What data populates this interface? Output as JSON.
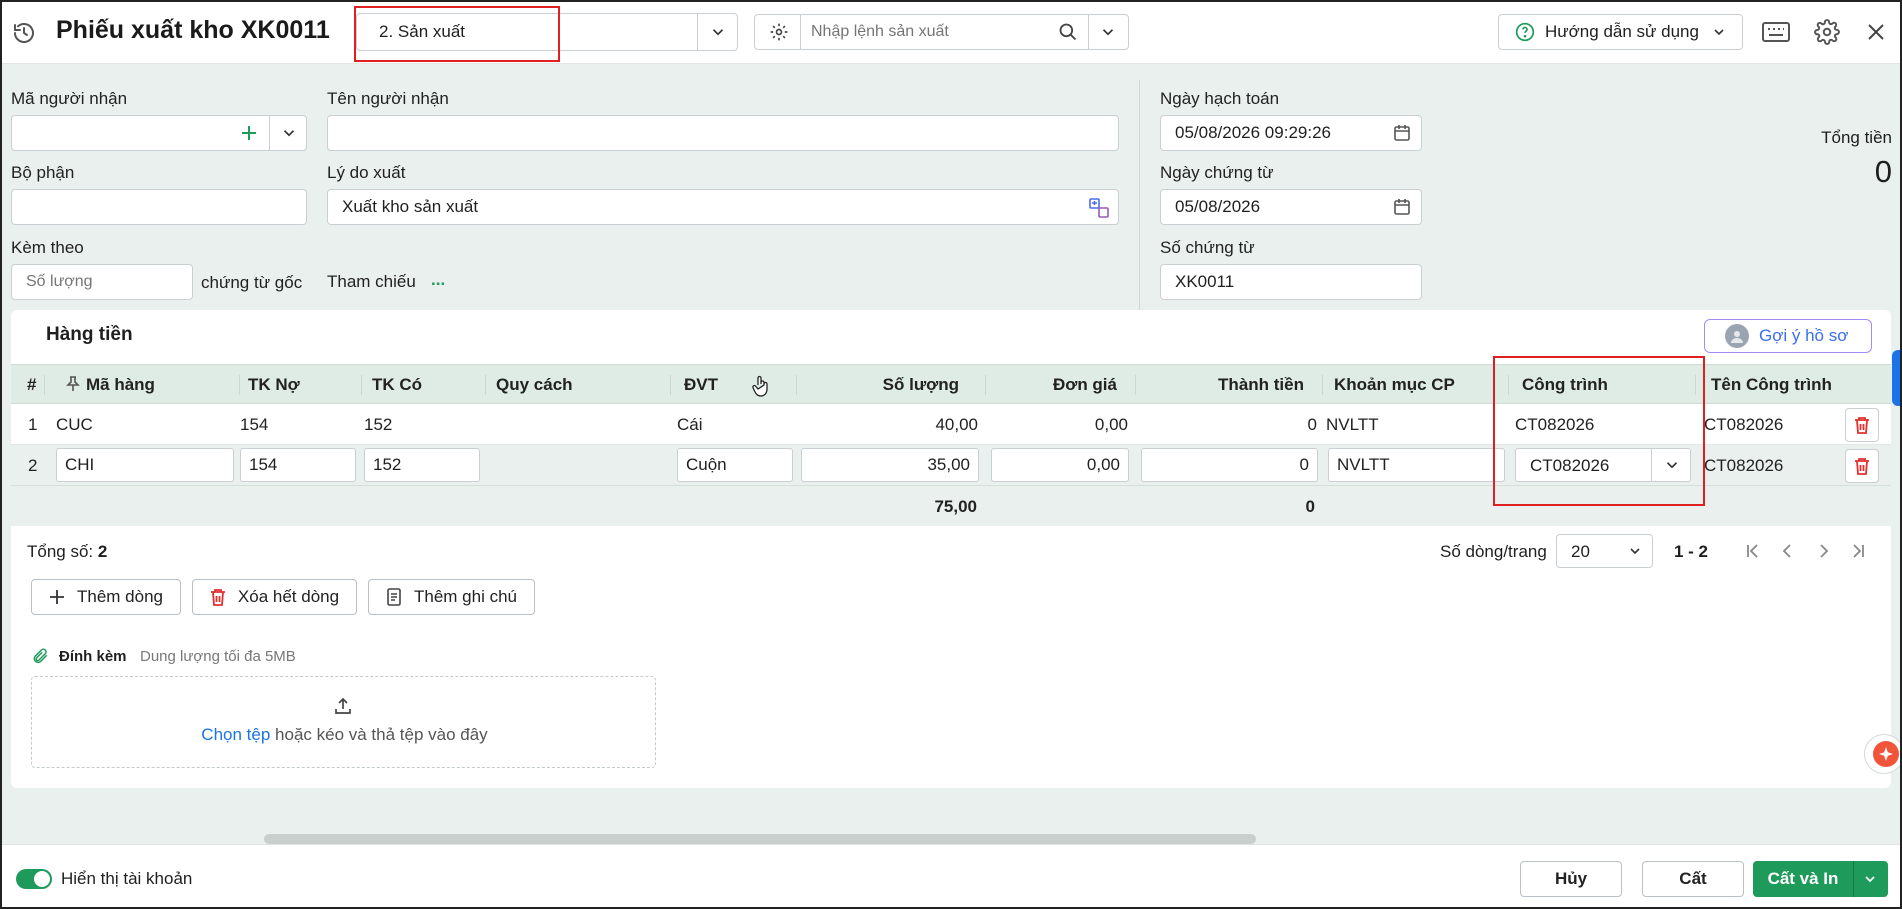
{
  "header": {
    "title": "Phiếu xuất kho XK0011",
    "type_select": "2. Sản xuất",
    "production_order_placeholder": "Nhập lệnh sản xuất",
    "help_label": "Hướng dẫn sử dụng"
  },
  "form": {
    "recipient_code_label": "Mã người nhận",
    "recipient_name_label": "Tên người nhận",
    "department_label": "Bộ phận",
    "reason_label": "Lý do xuất",
    "reason_value": "Xuất kho sản xuất",
    "attached_label": "Kèm theo",
    "quantity_placeholder": "Số lượng",
    "original_docs_label": "chứng từ gốc",
    "reference_label": "Tham chiếu",
    "reference_more": "...",
    "posting_date_label": "Ngày hạch toán",
    "posting_date_value": "05/08/2026 09:29:26",
    "doc_date_label": "Ngày chứng từ",
    "doc_date_value": "05/08/2026",
    "doc_number_label": "Số chứng từ",
    "doc_number_value": "XK0011",
    "total_label": "Tổng tiền",
    "total_value": "0"
  },
  "grid": {
    "section_title": "Hàng tiền",
    "suggest_label": "Gợi ý hồ sơ",
    "columns": {
      "num": "#",
      "item_code": "Mã hàng",
      "debit": "TK Nợ",
      "credit": "TK Có",
      "spec": "Quy cách",
      "unit": "ĐVT",
      "qty": "Số lượng",
      "price": "Đơn giá",
      "amount": "Thành tiền",
      "cost_item": "Khoản mục CP",
      "project": "Công trình",
      "project_name": "Tên Công trình"
    },
    "rows": [
      {
        "num": "1",
        "item_code": "CUC",
        "debit": "154",
        "credit": "152",
        "spec": "",
        "unit": "Cái",
        "qty": "40,00",
        "price": "0,00",
        "amount": "0",
        "cost_item": "NVLTT",
        "project": "CT082026",
        "project_name": "CT082026"
      },
      {
        "num": "2",
        "item_code": "CHI",
        "debit": "154",
        "credit": "152",
        "spec": "",
        "unit": "Cuộn",
        "qty": "35,00",
        "price": "0,00",
        "amount": "0",
        "cost_item": "NVLTT",
        "project": "CT082026",
        "project_name": "CT082026"
      }
    ],
    "totals": {
      "qty": "75,00",
      "amount": "0"
    }
  },
  "pager": {
    "total_label": "Tổng số:",
    "total_count": "2",
    "rows_per_page_label": "Số dòng/trang",
    "rows_per_page_value": "20",
    "range": "1 - 2"
  },
  "actions": {
    "add_row": "Thêm dòng",
    "delete_all": "Xóa hết dòng",
    "add_note": "Thêm ghi chú"
  },
  "attachment": {
    "label": "Đính kèm",
    "limit": "Dung lượng tối đa 5MB",
    "choose_file": "Chọn tệp",
    "drop_hint": "hoặc kéo và thả tệp vào đây"
  },
  "footer": {
    "show_account": "Hiển thị tài khoản",
    "cancel": "Hủy",
    "save": "Cất",
    "save_print": "Cất và In"
  },
  "colors": {
    "accent_green": "#1e9a5a",
    "highlight_red": "#e02020",
    "link_blue": "#1a73e8",
    "form_bg": "#e9f0ed",
    "grid_header_bg": "#dfebe5"
  }
}
